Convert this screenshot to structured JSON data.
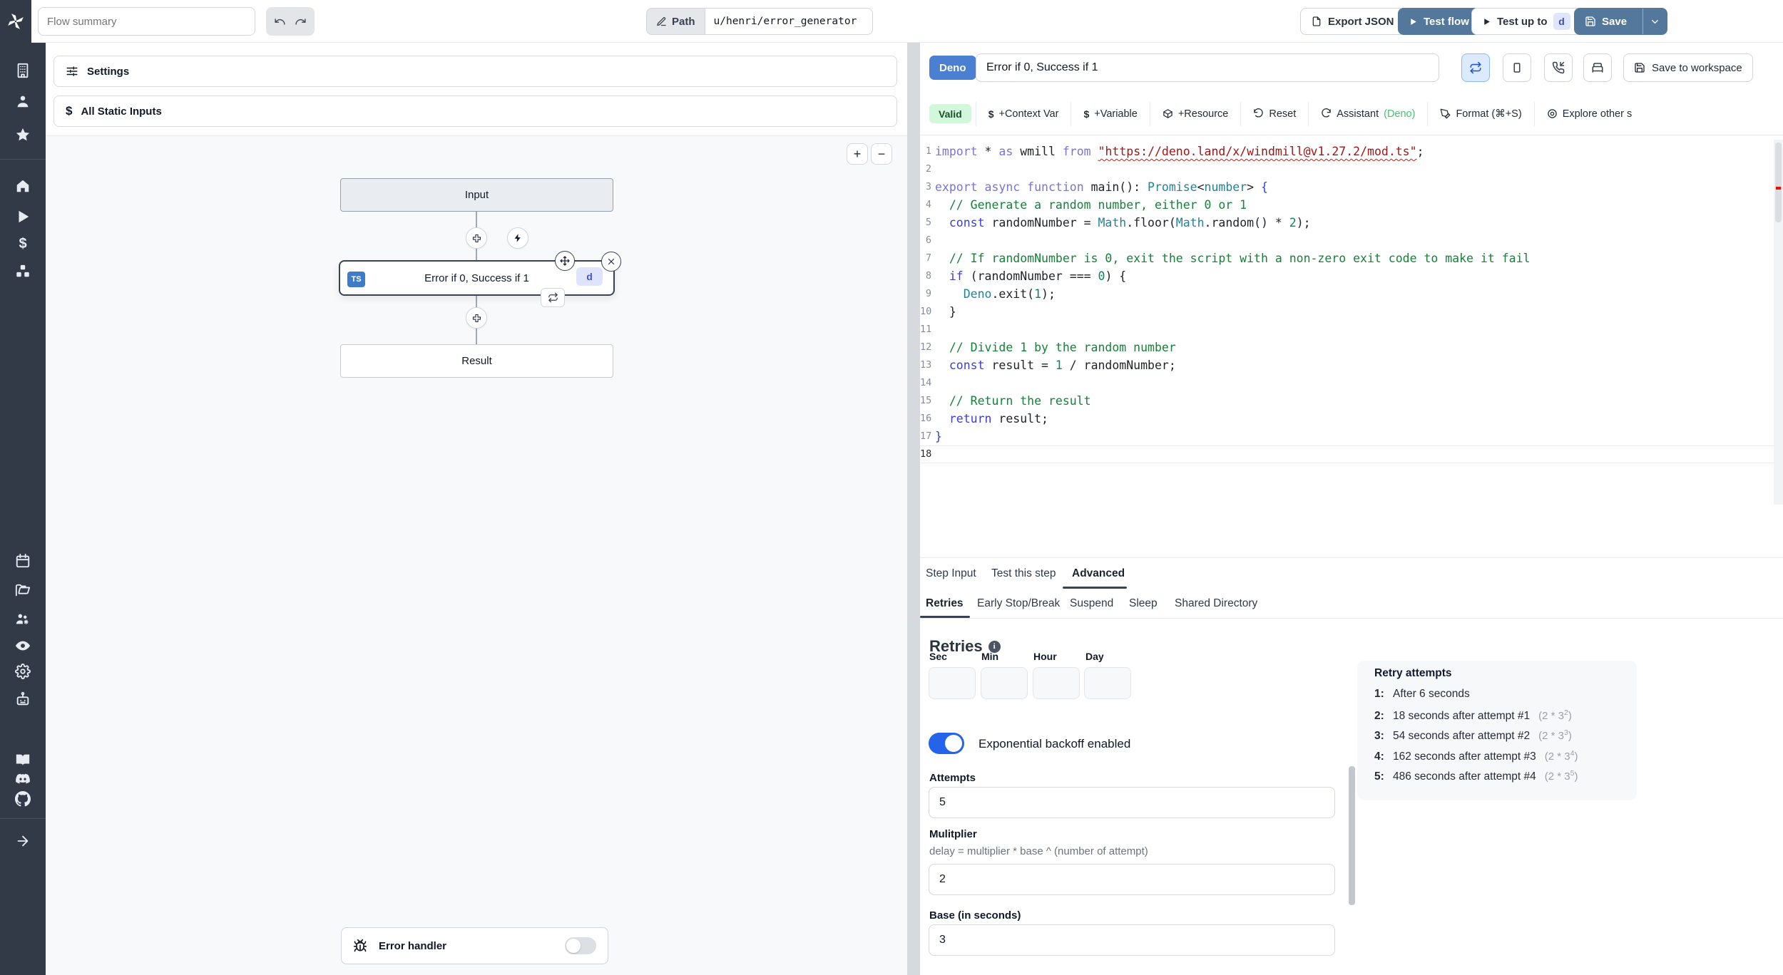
{
  "colors": {
    "primary_blue": "#53789c",
    "deno_blue": "#4b7fd2",
    "toggle_blue": "#2563eb",
    "valid_green": "#d3f7db",
    "sidebar_bg": "#323a48",
    "ts_badge": "#3e7cc9"
  },
  "topbar": {
    "flow_summary_placeholder": "Flow summary",
    "path_label": "Path",
    "path_value": "u/henri/error_generator",
    "export_json": "Export JSON",
    "test_flow": "Test flow",
    "test_up_to": "Test up to",
    "test_up_to_badge": "d",
    "save": "Save"
  },
  "sidebar": {
    "icons": [
      "building",
      "user",
      "star",
      "home",
      "play",
      "dollar",
      "cubes",
      "calendar",
      "folder",
      "users-gear",
      "eye",
      "gear",
      "robot",
      "book",
      "discord",
      "github",
      "arrow-right"
    ]
  },
  "flow": {
    "settings": "Settings",
    "all_static_inputs": "All Static Inputs",
    "zoom_in": "+",
    "zoom_out": "−",
    "input_node": "Input",
    "step_node": "Error if 0, Success if 1",
    "step_lang": "TS",
    "step_badge": "d",
    "result_node": "Result",
    "error_handler": "Error handler"
  },
  "right": {
    "header": {
      "lang_badge": "Deno",
      "title": "Error if 0, Success if 1",
      "save_to_workspace": "Save to workspace"
    },
    "toolbar": {
      "valid": "Valid",
      "context_var": "+Context Var",
      "variable": "+Variable",
      "resource": "+Resource",
      "reset": "Reset",
      "assistant": "Assistant",
      "assistant_lang": "(Deno)",
      "format": "Format (⌘+S)",
      "explore": "Explore other s"
    },
    "editor": {
      "lines": [
        [
          [
            "import",
            "k"
          ],
          [
            " ",
            "p"
          ],
          [
            "*",
            "p"
          ],
          [
            " ",
            "p"
          ],
          [
            "as",
            "k"
          ],
          [
            " wmill ",
            "p"
          ],
          [
            "from",
            "k"
          ],
          [
            " ",
            "p"
          ],
          [
            "\"https://deno.land/x/windmill@v1.27.2/mod.ts\"",
            "s"
          ],
          [
            ";",
            "p"
          ]
        ],
        [],
        [
          [
            "export",
            "k"
          ],
          [
            " ",
            "p"
          ],
          [
            "async",
            "k"
          ],
          [
            " ",
            "p"
          ],
          [
            "function",
            "k"
          ],
          [
            " main(): ",
            "p"
          ],
          [
            "Promise",
            "t"
          ],
          [
            "<",
            "p"
          ],
          [
            "number",
            "t"
          ],
          [
            "> ",
            "p"
          ],
          [
            "{",
            "br"
          ]
        ],
        [
          [
            "  ",
            "p"
          ],
          [
            "// Generate a random number, either 0 or 1",
            "c"
          ]
        ],
        [
          [
            "  ",
            "p"
          ],
          [
            "const",
            "b"
          ],
          [
            " randomNumber = ",
            "p"
          ],
          [
            "Math",
            "t"
          ],
          [
            ".floor(",
            "p"
          ],
          [
            "Math",
            "t"
          ],
          [
            ".random() ",
            "p"
          ],
          [
            "* ",
            "p"
          ],
          [
            "2",
            "n"
          ],
          [
            ");",
            "p"
          ]
        ],
        [],
        [
          [
            "  ",
            "p"
          ],
          [
            "// If randomNumber is 0, exit the script with a non-zero exit code to make it fail",
            "c"
          ]
        ],
        [
          [
            "  ",
            "p"
          ],
          [
            "if",
            "b"
          ],
          [
            " (randomNumber === ",
            "p"
          ],
          [
            "0",
            "n"
          ],
          [
            ") {",
            "p"
          ]
        ],
        [
          [
            "    ",
            "p"
          ],
          [
            "Deno",
            "t"
          ],
          [
            ".exit(",
            "p"
          ],
          [
            "1",
            "n"
          ],
          [
            ");",
            "p"
          ]
        ],
        [
          [
            "  }",
            "p"
          ]
        ],
        [],
        [
          [
            "  ",
            "p"
          ],
          [
            "// Divide 1 by the random number",
            "c"
          ]
        ],
        [
          [
            "  ",
            "p"
          ],
          [
            "const",
            "b"
          ],
          [
            " result = ",
            "p"
          ],
          [
            "1",
            "n"
          ],
          [
            " / randomNumber;",
            "p"
          ]
        ],
        [],
        [
          [
            "  ",
            "p"
          ],
          [
            "// Return the result",
            "c"
          ]
        ],
        [
          [
            "  ",
            "p"
          ],
          [
            "return",
            "b"
          ],
          [
            " result;",
            "p"
          ]
        ],
        [
          [
            "}",
            "br"
          ]
        ],
        []
      ]
    },
    "tabs": {
      "step_input": "Step Input",
      "test_this_step": "Test this step",
      "advanced": "Advanced"
    },
    "subtabs": {
      "retries": "Retries",
      "early_stop": "Early Stop/Break",
      "suspend": "Suspend",
      "sleep": "Sleep",
      "shared_directory": "Shared Directory"
    },
    "retries": {
      "heading": "Retries",
      "time_labels": [
        "Sec",
        "Min",
        "Hour",
        "Day"
      ],
      "backoff_label": "Exponential backoff enabled",
      "attempts_label": "Attempts",
      "attempts_value": "5",
      "multiplier_label": "Mulitplier",
      "multiplier_help": "delay = multiplier * base ^ (number of attempt)",
      "multiplier_value": "2",
      "base_label": "Base (in seconds)",
      "base_value": "3"
    },
    "retry_attempts": {
      "title": "Retry attempts",
      "items": [
        {
          "n": "1:",
          "text": "After 6 seconds"
        },
        {
          "n": "2:",
          "text": "18 seconds after attempt #1",
          "f": "(2 * 3",
          "e": "2",
          "c": ")"
        },
        {
          "n": "3:",
          "text": "54 seconds after attempt #2",
          "f": "(2 * 3",
          "e": "3",
          "c": ")"
        },
        {
          "n": "4:",
          "text": "162 seconds after attempt #3",
          "f": "(2 * 3",
          "e": "4",
          "c": ")"
        },
        {
          "n": "5:",
          "text": "486 seconds after attempt #4",
          "f": "(2 * 3",
          "e": "5",
          "c": ")"
        }
      ]
    }
  }
}
